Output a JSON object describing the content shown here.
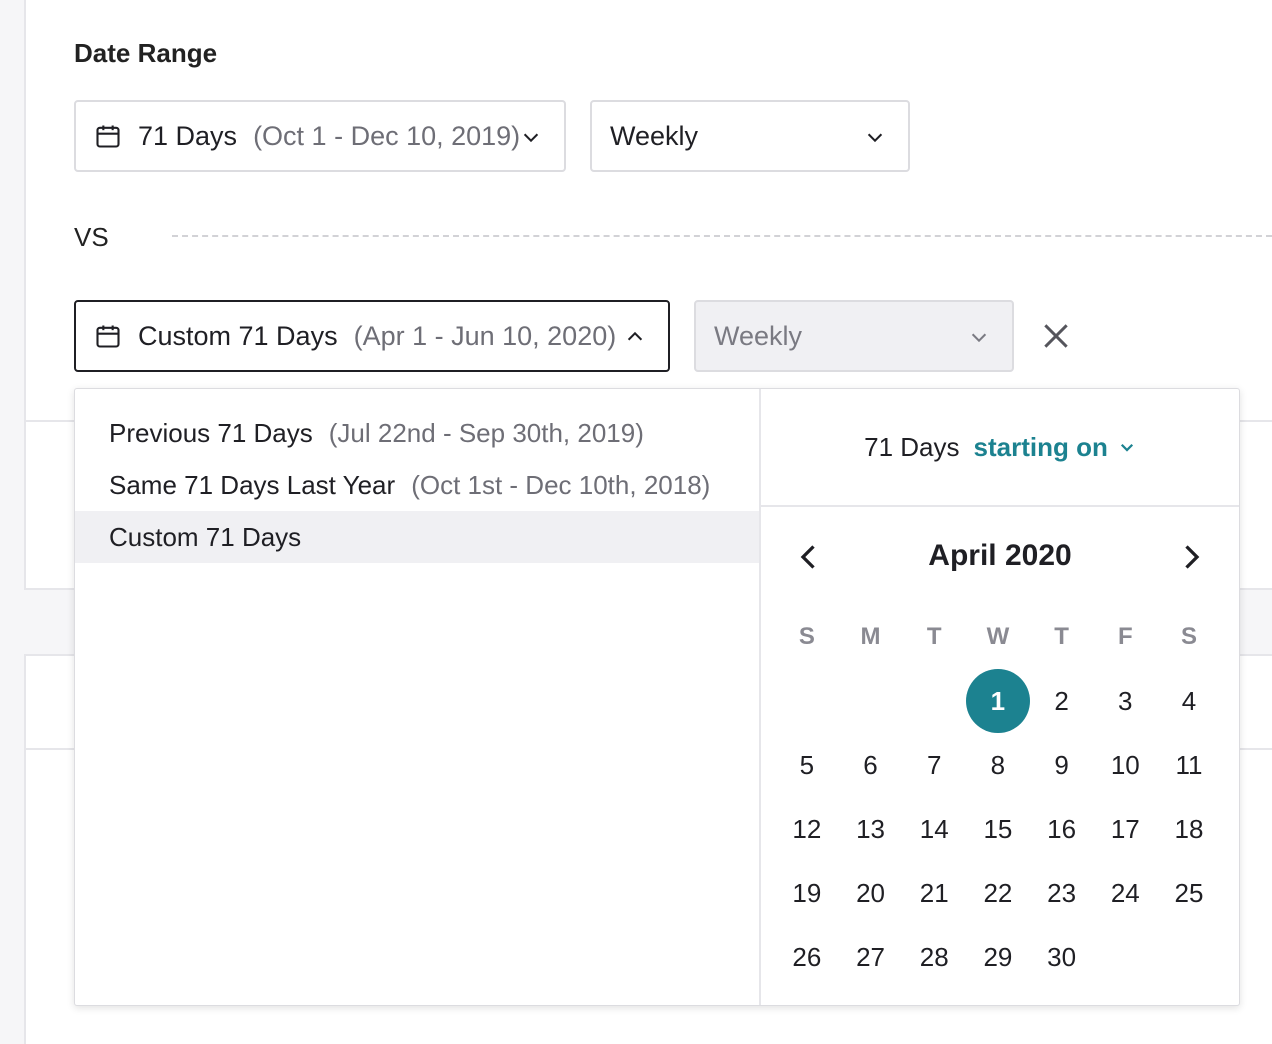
{
  "section_title": "Date Range",
  "primary": {
    "range_label": "71 Days",
    "range_dates": "(Oct 1 - Dec 10, 2019)",
    "interval": "Weekly"
  },
  "vs_label": "VS",
  "compare": {
    "range_label": "Custom 71 Days",
    "range_dates": "(Apr 1 - Jun 10, 2020)",
    "interval": "Weekly"
  },
  "options": [
    {
      "label": "Previous 71 Days",
      "dates": "(Jul 22nd - Sep 30th, 2019)",
      "selected": false
    },
    {
      "label": "Same 71 Days Last Year",
      "dates": "(Oct 1st - Dec 10th, 2018)",
      "selected": false
    },
    {
      "label": "Custom 71 Days",
      "dates": "",
      "selected": true
    }
  ],
  "calendar": {
    "duration_label": "71 Days",
    "mode_label": "starting on",
    "month_title": "April 2020",
    "weekdays": [
      "S",
      "M",
      "T",
      "W",
      "T",
      "F",
      "S"
    ],
    "first_weekday_index": 3,
    "days_in_month": 30,
    "selected_day": 1
  },
  "colors": {
    "accent": "#1c8290",
    "muted_text": "#6e6e76",
    "border": "#dcdce0"
  },
  "icons": {
    "calendar": "calendar-icon",
    "chevron": "chevron-down-icon",
    "close": "close-icon"
  }
}
